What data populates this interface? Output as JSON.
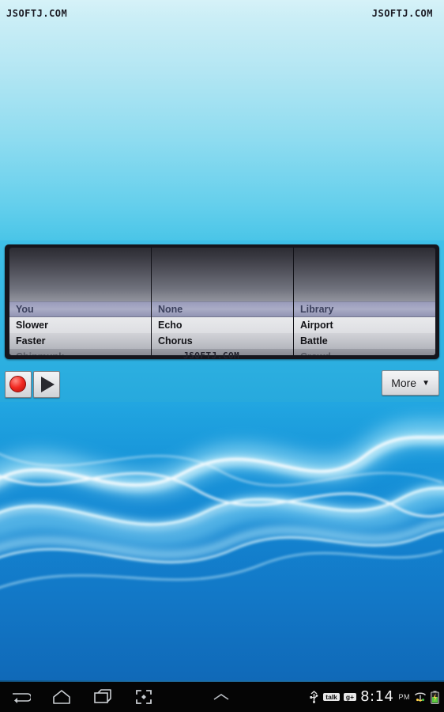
{
  "watermarks": {
    "top_left": "JSOFTJ.COM",
    "top_right": "JSOFTJ.COM",
    "center": "JSOFTJ.COM"
  },
  "app": {
    "spinners": [
      {
        "name": "voice-pitch-spinner",
        "selected": "You",
        "items": [
          "You",
          "Slower",
          "Faster",
          "Chipmunk"
        ]
      },
      {
        "name": "voice-effect-spinner",
        "selected": "None",
        "items": [
          "None",
          "Echo",
          "Chorus",
          ""
        ]
      },
      {
        "name": "background-sound-spinner",
        "selected": "Library",
        "items": [
          "Library",
          "Airport",
          "Battle",
          "Crowd"
        ]
      }
    ],
    "transport": {
      "record_label": "Record",
      "record_icon": "record-circle-icon",
      "play_label": "Play",
      "play_icon": "play-triangle-icon"
    },
    "more_button": {
      "label": "More",
      "caret": "▼"
    }
  },
  "system_bar": {
    "nav_buttons": [
      {
        "name": "back-button",
        "icon": "back-arrow-icon"
      },
      {
        "name": "home-button",
        "icon": "home-icon"
      },
      {
        "name": "recents-button",
        "icon": "recent-apps-icon"
      },
      {
        "name": "screenshot-button",
        "icon": "screenshot-icon"
      }
    ],
    "chevron_icon": "chevron-up-icon",
    "status": {
      "usb_icon": "usb-icon",
      "talk_badge": "talk",
      "gplus_badge": "g+",
      "time": "8:14",
      "meridiem": "PM",
      "wifi_icon": "wifi-icon",
      "battery_icon": "battery-icon"
    }
  },
  "colors": {
    "accent_blue": "#2fb3e2",
    "record_red": "#f22a22",
    "selection_lavender": "#aaacc6",
    "panel_dark": "#15151c"
  }
}
